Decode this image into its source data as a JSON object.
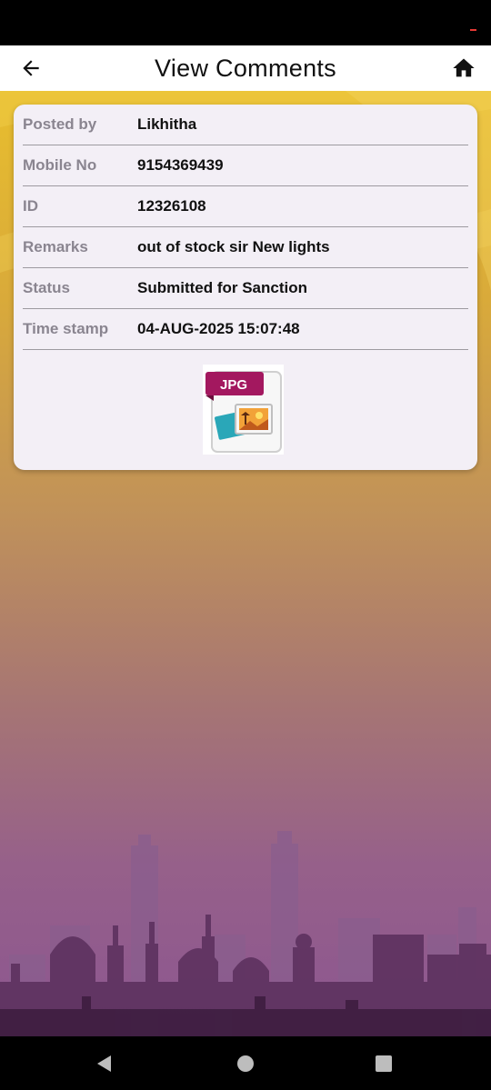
{
  "app_bar": {
    "title": "View Comments",
    "back_icon": "arrow-back-icon",
    "home_icon": "home-icon"
  },
  "comment": {
    "fields": [
      {
        "label": "Posted by",
        "value": "Likhitha"
      },
      {
        "label": "Mobile No",
        "value": "9154369439"
      },
      {
        "label": "ID",
        "value": "12326108"
      },
      {
        "label": "Remarks",
        "value": "out of stock sir New lights"
      },
      {
        "label": "Status",
        "value": "Submitted for Sanction"
      },
      {
        "label": "Time stamp",
        "value": "04-AUG-2025 15:07:48"
      }
    ],
    "attachment": {
      "type_label": "JPG",
      "icon": "jpg-file-icon"
    }
  },
  "nav": {
    "back_icon": "nav-back-icon",
    "home_icon": "nav-home-icon",
    "recents_icon": "nav-recents-icon"
  },
  "colors": {
    "gradient_top": "#e8be2e",
    "gradient_bottom": "#8c5690",
    "card_bg": "#f3eff6",
    "label_gray": "#8a8590",
    "jpg_ribbon": "#a3185f"
  }
}
